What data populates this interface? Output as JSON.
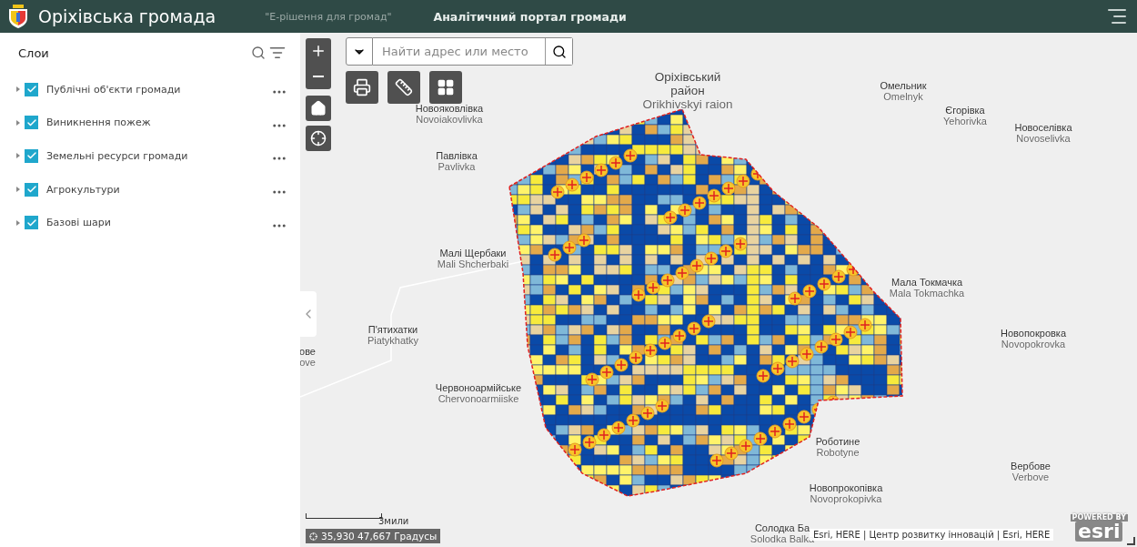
{
  "header": {
    "title": "Оріхівська громада",
    "subtitle": "\"Е-рішення для громад\"",
    "portal": "Аналітичний портал громади"
  },
  "layers_panel": {
    "title": "Слои",
    "layers": [
      {
        "label": "Публічні об'єкти громади",
        "checked": true
      },
      {
        "label": "Виникнення пожеж",
        "checked": true
      },
      {
        "label": "Земельні ресурси громади",
        "checked": true
      },
      {
        "label": "Агрокультури",
        "checked": true
      },
      {
        "label": "Базові шари",
        "checked": true
      }
    ]
  },
  "search": {
    "placeholder": "Найти адрес или место"
  },
  "map_labels": [
    {
      "name": "Оріхівський",
      "name_2": "район",
      "name_en": "Orikhivskyi raion"
    },
    {
      "name": "Новояковлівка",
      "name_en": "Novoiakovlivka"
    },
    {
      "name": "Павлівка",
      "name_en": "Pavlivka"
    },
    {
      "name": "Малі Щербаки",
      "name_en": "Mali Shcherbaki"
    },
    {
      "name": "П'ятихатки",
      "name_en": "Piatykhatky"
    },
    {
      "name": "ове",
      "name_en": "ove"
    },
    {
      "name": "Червоноармійське",
      "name_en": "Chervonoarmiiske"
    },
    {
      "name": "Омельник",
      "name_en": "Omelnyk"
    },
    {
      "name": "Єгорівка",
      "name_en": "Yehorivka"
    },
    {
      "name": "Новоселівка",
      "name_en": "Novoselivka"
    },
    {
      "name": "Мала Токмачка",
      "name_en": "Mala Tokmachka"
    },
    {
      "name": "Новопокровка",
      "name_en": "Novopokrovka"
    },
    {
      "name": "Роботине",
      "name_en": "Robotyne"
    },
    {
      "name": "Вербове",
      "name_en": "Verbove"
    },
    {
      "name": "Новопрокопівка",
      "name_en": "Novoprokopivka"
    },
    {
      "name": "Солодка Ба",
      "name_en": "Solodka Balka"
    }
  ],
  "scale": "3мили",
  "coordinates": "35,930 47,667 Градусы",
  "attribution": "Esri, HERE | Центр розвитку інновацій | Esri, HERE",
  "logo": {
    "top": "POWERED BY",
    "main": "esri"
  }
}
